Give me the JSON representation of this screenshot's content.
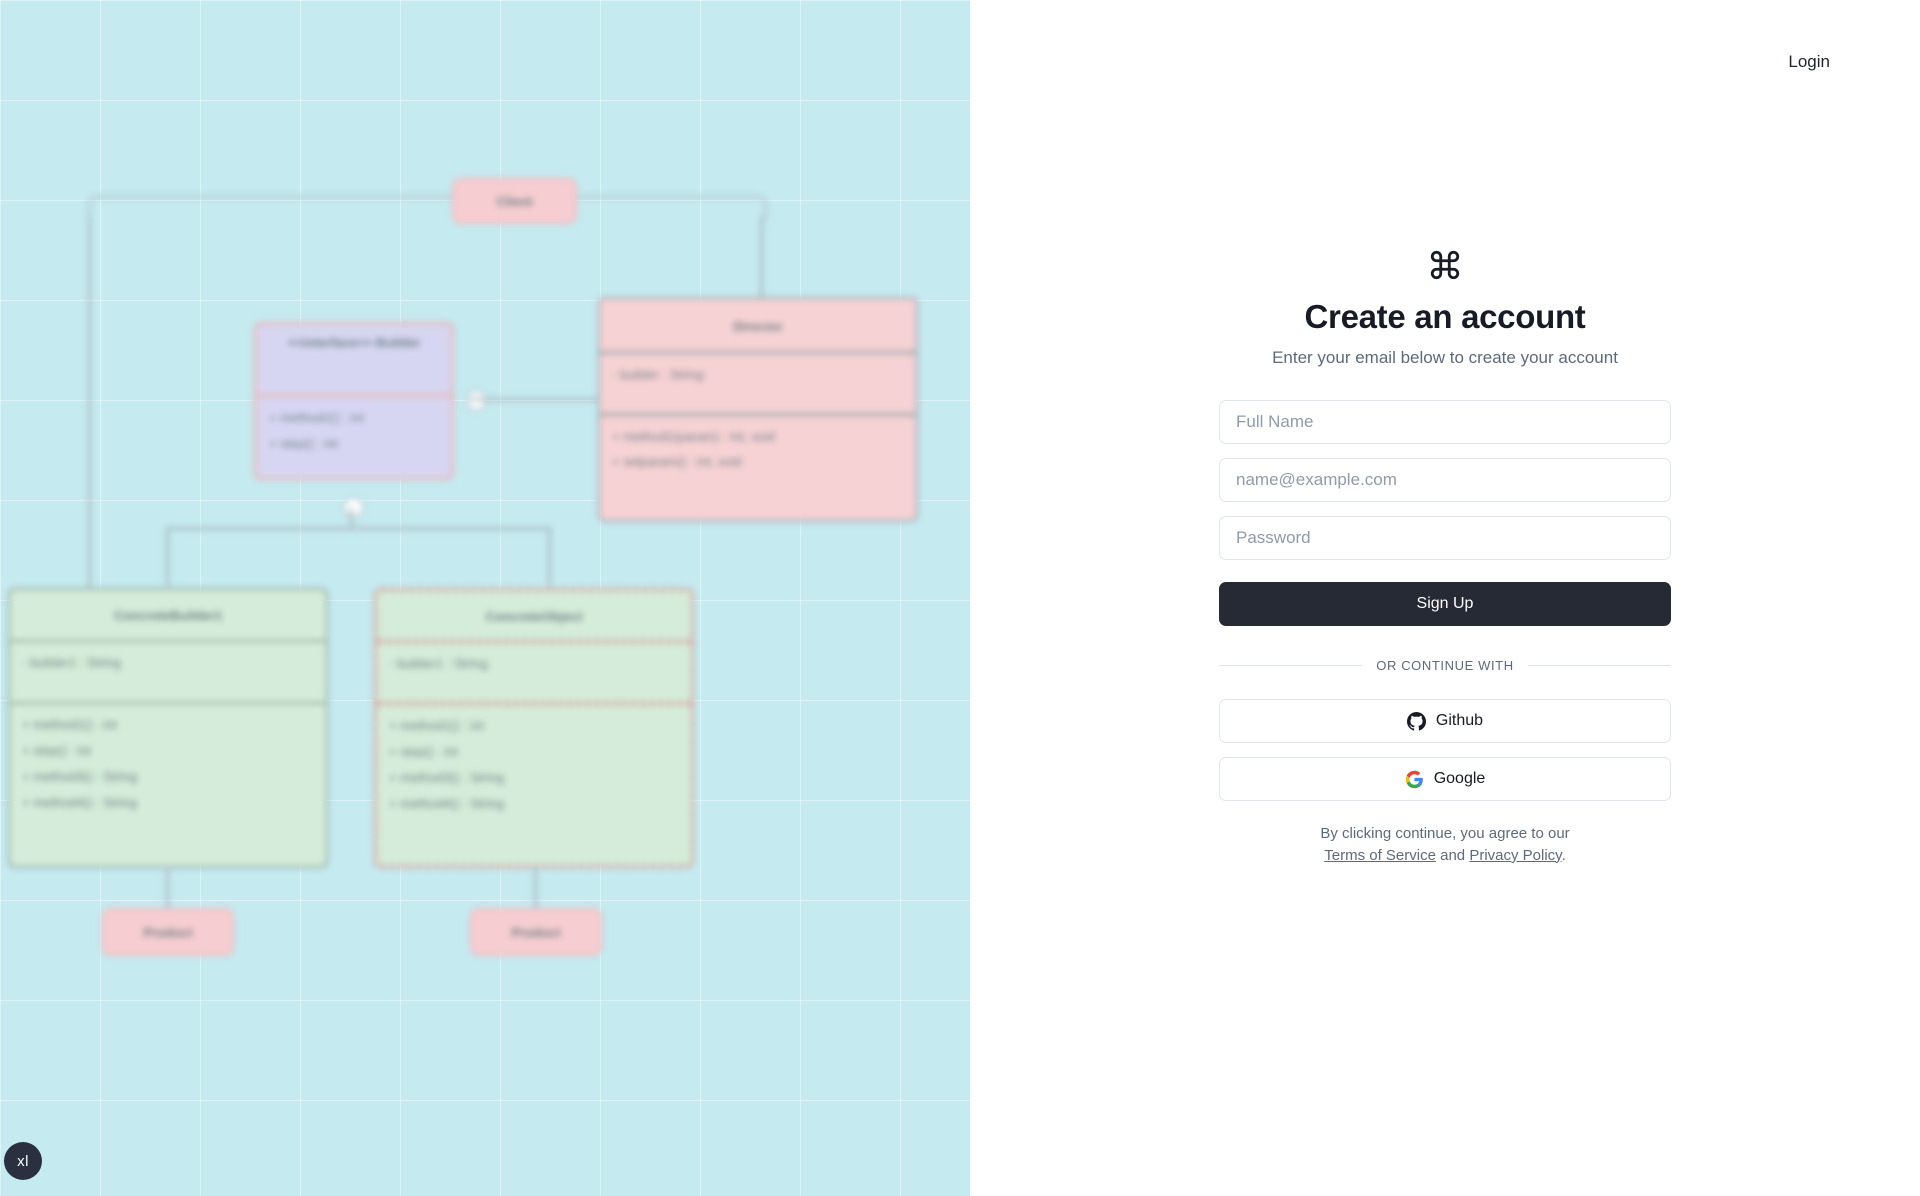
{
  "header": {
    "login_label": "Login"
  },
  "auth": {
    "brand_icon": "command-icon",
    "title": "Create an account",
    "subtitle": "Enter your email below to create your account",
    "fields": {
      "fullname_placeholder": "Full Name",
      "email_placeholder": "name@example.com",
      "password_placeholder": "Password"
    },
    "submit_label": "Sign Up",
    "divider_label": "OR CONTINUE WITH",
    "oauth": [
      {
        "label": "Github",
        "icon": "github-icon"
      },
      {
        "label": "Google",
        "icon": "google-icon"
      }
    ],
    "legal": {
      "prefix": "By clicking continue, you agree to our",
      "terms_label": "Terms of Service",
      "conjunction": "and",
      "privacy_label": "Privacy Policy",
      "suffix": "."
    }
  },
  "canvas": {
    "background_color": "#c5eaf0",
    "size_badge": "xl",
    "diagram": {
      "note": "blurred UML class diagram - builder pattern",
      "nodes": [
        {
          "id": "client",
          "label": "Client",
          "kind": "pill"
        },
        {
          "id": "builder-interface",
          "label": "<<interface>> Builder",
          "kind": "class"
        },
        {
          "id": "director",
          "label": "Director",
          "kind": "class"
        },
        {
          "id": "concrete-builder",
          "label": "ConcreteBuilder1",
          "kind": "class"
        },
        {
          "id": "concrete-object",
          "label": "ConcreteObject",
          "kind": "class"
        },
        {
          "id": "product-1",
          "label": "Product",
          "kind": "pill"
        },
        {
          "id": "product-2",
          "label": "Product",
          "kind": "pill"
        }
      ]
    }
  }
}
